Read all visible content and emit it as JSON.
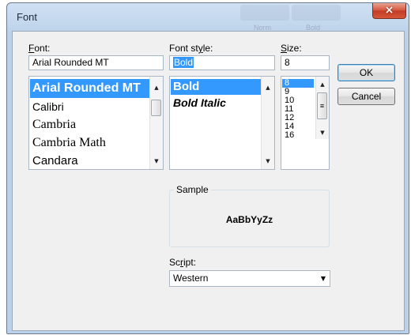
{
  "window": {
    "title": "Font",
    "close_glyph": "×"
  },
  "ghost_labels": [
    "Norm",
    "Bold"
  ],
  "font": {
    "label_accel": "F",
    "label_rest": "ont:",
    "value": "Arial Rounded MT",
    "items": [
      "Arial Rounded MT",
      "Calibri",
      "Cambria",
      "Cambria Math",
      "Candara"
    ],
    "selected": "Arial Rounded MT"
  },
  "style": {
    "label_pre": "Font st",
    "label_accel": "y",
    "label_post": "le:",
    "value": "Bold",
    "items": [
      "Bold",
      "Bold Italic"
    ],
    "selected": "Bold"
  },
  "size": {
    "label_accel": "S",
    "label_rest": "ize:",
    "value": "8",
    "items": [
      "8",
      "9",
      "10",
      "11",
      "12",
      "14",
      "16"
    ],
    "selected": "8"
  },
  "buttons": {
    "ok": "OK",
    "cancel": "Cancel"
  },
  "sample": {
    "legend": "Sample",
    "text": "AaBbYyZz"
  },
  "script": {
    "label_pre": "Sc",
    "label_accel": "r",
    "label_post": "ipt:",
    "value": "Western"
  },
  "icons": {
    "up": "▲",
    "down": "▼",
    "grip": "≡"
  }
}
